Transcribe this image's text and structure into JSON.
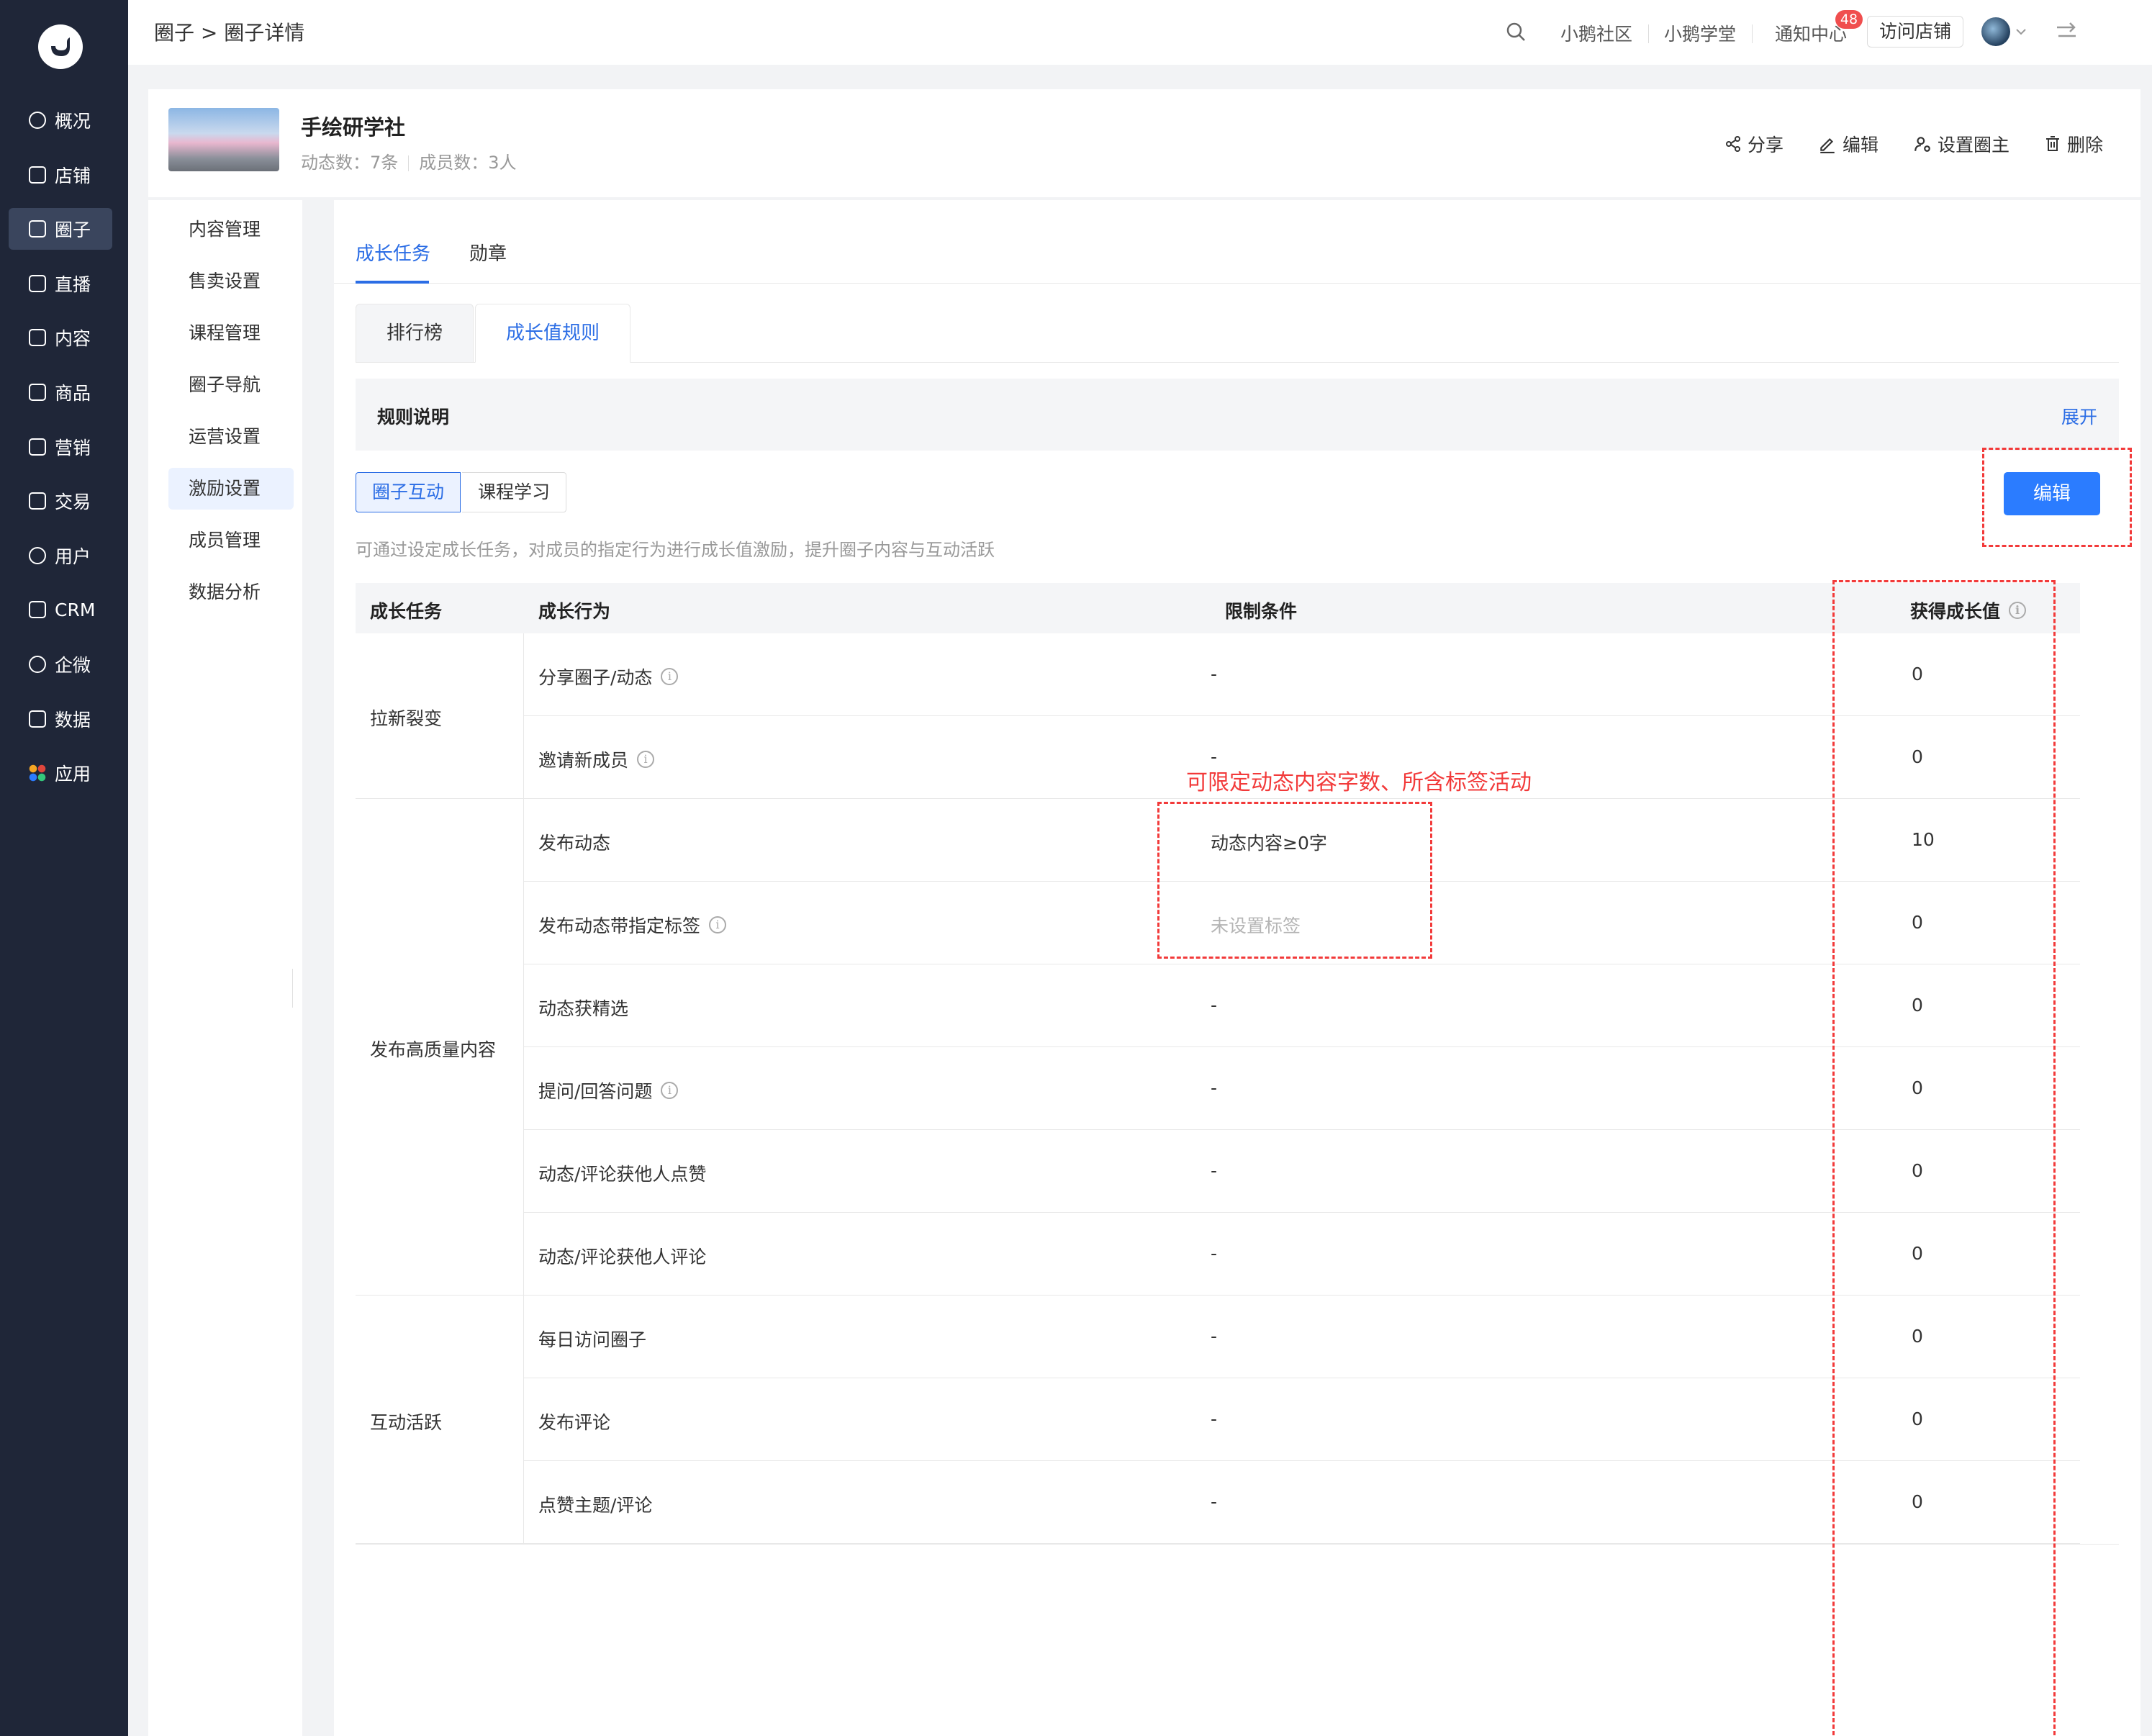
{
  "sidebar": {
    "items": [
      {
        "label": "概况",
        "icon": "pie-chart-icon"
      },
      {
        "label": "店铺",
        "icon": "shop-icon"
      },
      {
        "label": "圈子",
        "icon": "users-icon"
      },
      {
        "label": "直播",
        "icon": "live-icon"
      },
      {
        "label": "内容",
        "icon": "document-icon"
      },
      {
        "label": "商品",
        "icon": "goods-icon"
      },
      {
        "label": "营销",
        "icon": "megaphone-icon"
      },
      {
        "label": "交易",
        "icon": "trade-icon"
      },
      {
        "label": "用户",
        "icon": "user-icon"
      },
      {
        "label": "CRM",
        "icon": "crm-icon"
      },
      {
        "label": "企微",
        "icon": "wecom-icon"
      },
      {
        "label": "数据",
        "icon": "data-icon"
      },
      {
        "label": "应用",
        "icon": "apps-icon"
      }
    ],
    "active": "圈子"
  },
  "header": {
    "breadcrumb": "圈子 > 圈子详情",
    "links": [
      "小鹅社区",
      "小鹅学堂",
      "通知中心"
    ],
    "notification_count": "48",
    "visit_store": "访问店铺"
  },
  "circle": {
    "name": "手绘研学社",
    "posts": "动态数：7条",
    "members": "成员数：3人",
    "actions": [
      "分享",
      "编辑",
      "设置圈主",
      "删除"
    ]
  },
  "subnav": {
    "items": [
      "内容管理",
      "售卖设置",
      "课程管理",
      "圈子导航",
      "运营设置",
      "激励设置",
      "成员管理",
      "数据分析"
    ],
    "active": "激励设置"
  },
  "main": {
    "tabs": [
      "成长任务",
      "勋章"
    ],
    "subtabs": [
      "排行榜",
      "成长值规则"
    ],
    "rules_title": "规则说明",
    "rules_expand": "展开",
    "segments": [
      "圈子互动",
      "课程学习"
    ],
    "edit_label": "编辑",
    "description": "可通过设定成长任务，对成员的指定行为进行成长值激励，提升圈子内容与互动活跃"
  },
  "table": {
    "headers": [
      "成长任务",
      "成长行为",
      "限制条件",
      "获得成长值"
    ],
    "groups": [
      {
        "name": "拉新裂变",
        "rows": [
          {
            "behavior": "分享圈子/动态",
            "info": true,
            "limit": "-",
            "value": "0"
          },
          {
            "behavior": "邀请新成员",
            "info": true,
            "limit": "-",
            "value": "0"
          }
        ]
      },
      {
        "name": "发布高质量内容",
        "rows": [
          {
            "behavior": "发布动态",
            "info": false,
            "limit": "动态内容≥0字",
            "value": "10"
          },
          {
            "behavior": "发布动态带指定标签",
            "info": true,
            "limit": "未设置标签",
            "value": "0"
          },
          {
            "behavior": "动态获精选",
            "info": false,
            "limit": "-",
            "value": "0"
          },
          {
            "behavior": "提问/回答问题",
            "info": true,
            "limit": "-",
            "value": "0"
          },
          {
            "behavior": "动态/评论获他人点赞",
            "info": false,
            "limit": "-",
            "value": "0"
          },
          {
            "behavior": "动态/评论获他人评论",
            "info": false,
            "limit": "-",
            "value": "0"
          }
        ]
      },
      {
        "name": "互动活跃",
        "rows": [
          {
            "behavior": "每日访问圈子",
            "info": false,
            "limit": "-",
            "value": "0"
          },
          {
            "behavior": "发布评论",
            "info": false,
            "limit": "-",
            "value": "0"
          },
          {
            "behavior": "点赞主题/评论",
            "info": false,
            "limit": "-",
            "value": "0"
          }
        ]
      }
    ]
  },
  "annotation": {
    "text": "可限定动态内容字数、所含标签活动",
    "color": "#f23a3a"
  },
  "colors": {
    "accent": "#2b6de5",
    "sidebar_bg": "#1f2638",
    "button_primary": "#2b7cff"
  }
}
